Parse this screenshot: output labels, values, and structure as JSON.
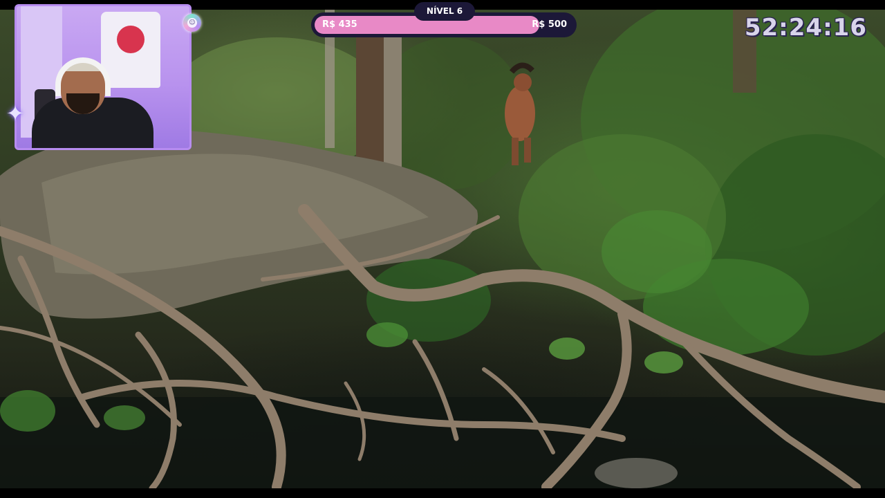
{
  "stream": {
    "timer": "52:24:16"
  },
  "goal": {
    "level_label": "NÍVEL 6",
    "current_label": "R$ 435",
    "target_label": "R$ 500",
    "progress_fraction": 0.87,
    "bar_color": "#e889c6",
    "track_color": "#1c1838"
  },
  "webcam": {
    "frame_color": "#b78cf0"
  },
  "overlay_icons": {
    "left": "sparkle-icon",
    "top_right": "smiley-emoji-icon"
  }
}
